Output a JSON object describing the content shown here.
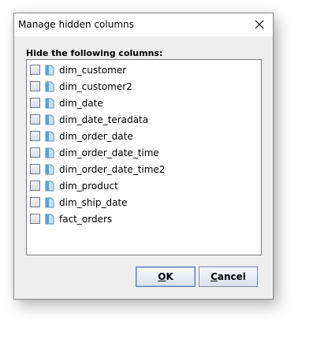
{
  "dialog": {
    "title": "Manage hidden columns",
    "close_icon": "close-icon"
  },
  "section": {
    "label": "Hide the following columns:"
  },
  "columns": [
    {
      "label": "dim_customer",
      "checked": false,
      "icon": "table-icon"
    },
    {
      "label": "dim_customer2",
      "checked": false,
      "icon": "table-icon"
    },
    {
      "label": "dim_date",
      "checked": false,
      "icon": "table-icon"
    },
    {
      "label": "dim_date_teradata",
      "checked": false,
      "icon": "table-icon"
    },
    {
      "label": "dim_order_date",
      "checked": false,
      "icon": "table-icon"
    },
    {
      "label": "dim_order_date_time",
      "checked": false,
      "icon": "table-icon"
    },
    {
      "label": "dim_order_date_time2",
      "checked": false,
      "icon": "table-icon"
    },
    {
      "label": "dim_product",
      "checked": false,
      "icon": "table-icon"
    },
    {
      "label": "dim_ship_date",
      "checked": false,
      "icon": "table-icon"
    },
    {
      "label": "fact_orders",
      "checked": false,
      "icon": "table-icon"
    }
  ],
  "buttons": {
    "ok": {
      "mnemonic": "O",
      "rest": "K"
    },
    "cancel": {
      "mnemonic": "C",
      "rest": "ancel"
    }
  },
  "colors": {
    "dialog_bg": "#eeeeee",
    "titlebar_bg": "#ffffff",
    "icon_blue": "#5aa0d8"
  }
}
